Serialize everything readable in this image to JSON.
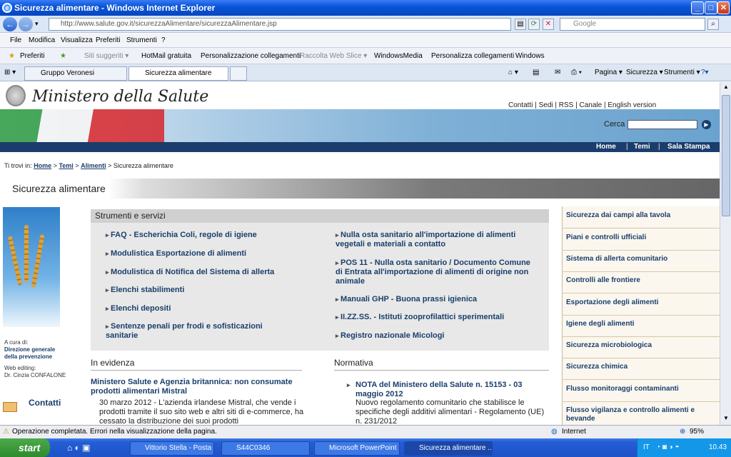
{
  "window": {
    "title": "Sicurezza alimentare - Windows Internet Explorer"
  },
  "address": {
    "url": "http://www.salute.gov.it/sicurezzaAlimentare/sicurezzaAlimentare.jsp",
    "search_placeholder": "Google"
  },
  "menu": [
    "File",
    "Modifica",
    "Visualizza",
    "Preferiti",
    "Strumenti",
    "?"
  ],
  "favorites": {
    "label": "Preferiti",
    "items": [
      "Siti suggeriti ▾",
      "HotMail gratuita",
      "Personalizzazione collegamenti",
      "Raccolta Web Slice ▾",
      "WindowsMedia",
      "Personalizza collegamenti",
      "Windows"
    ]
  },
  "tabs": [
    "Gruppo Veronesi",
    "Sicurezza alimentare"
  ],
  "commands": [
    "Pagina ▾",
    "Sicurezza ▾",
    "Strumenti ▾"
  ],
  "site": {
    "logo": "Ministero della Salute",
    "toplinks": "Contatti  |  Sedi  |  RSS    |  Canale      |  English version",
    "search_label": "Cerca",
    "nav": [
      "Home",
      "Temi",
      "Sala Stampa"
    ],
    "breadcrumb": {
      "prefix": "Ti trovi in:",
      "home": "Home",
      "temi": "Temi",
      "alimenti": "Alimenti",
      "current": "> Sicurezza alimentare"
    },
    "page_title": "Sicurezza alimentare",
    "left": {
      "cura_label": "A cura di:",
      "cura_value": "Direzione generale della prevenzione",
      "editing_label": "Web editing:",
      "editing_value": "Dr. Cinzia CONFALONE",
      "contatti": "Contatti"
    },
    "strumenti": {
      "heading": "Strumenti e servizi",
      "left": [
        "FAQ - Escherichia Coli, regole di igiene",
        "Modulistica Esportazione di alimenti",
        "Modulistica di Notifica del Sistema di allerta",
        "Elenchi stabilimenti",
        "Elenchi depositi",
        "Sentenze penali per frodi e sofisticazioni sanitarie"
      ],
      "right": [
        "Nulla osta sanitario all'importazione di alimenti vegetali e materiali a contatto",
        "POS 11 - Nulla osta sanitario / Documento Comune di Entrata all'importazione di alimenti di origine non animale",
        "Manuali GHP - Buona prassi igienica",
        "II.ZZ.SS. - Istituti zooprofilattici sperimentali",
        "Registro nazionale Micologi"
      ]
    },
    "evidenza": {
      "heading": "In evidenza",
      "title": "Ministero Salute e Agenzia britannica: non consumate prodotti alimentari Mistral",
      "text": "30 marzo 2012 - L'azienda irlandese Mistral, che vende i prodotti tramite il suo sito web e altri siti di e-commerce, ha cessato la distribuzione dei suoi prodotti"
    },
    "normativa": {
      "heading": "Normativa",
      "title": "NOTA del Ministero della Salute n. 15153 - 03 maggio 2012",
      "text": "Nuovo regolamento comunitario che stabilisce le specifiche degli additivi alimentari - Regolamento (UE) n. 231/2012"
    },
    "right_menu": [
      "Sicurezza dai campi alla tavola",
      "Piani e controlli ufficiali",
      "Sistema di allerta comunitario",
      "Controlli alle frontiere",
      "Esportazione degli alimenti",
      "Igiene degli alimenti",
      "Sicurezza microbiologica",
      "Sicurezza chimica",
      "Flusso monitoraggi contaminanti",
      "Flusso vigilanza e controllo alimenti e bevande"
    ]
  },
  "status": {
    "text": "Operazione completata. Errori nella visualizzazione della pagina.",
    "zone": "Internet",
    "zoom": "95%"
  },
  "taskbar": {
    "start": "start",
    "tasks": [
      "Vittorio Stella - Posta ...",
      "S44C0346",
      "Microsoft PowerPoint ...",
      "Sicurezza alimentare ..."
    ],
    "tray_lang": "IT",
    "clock": "10.43"
  }
}
